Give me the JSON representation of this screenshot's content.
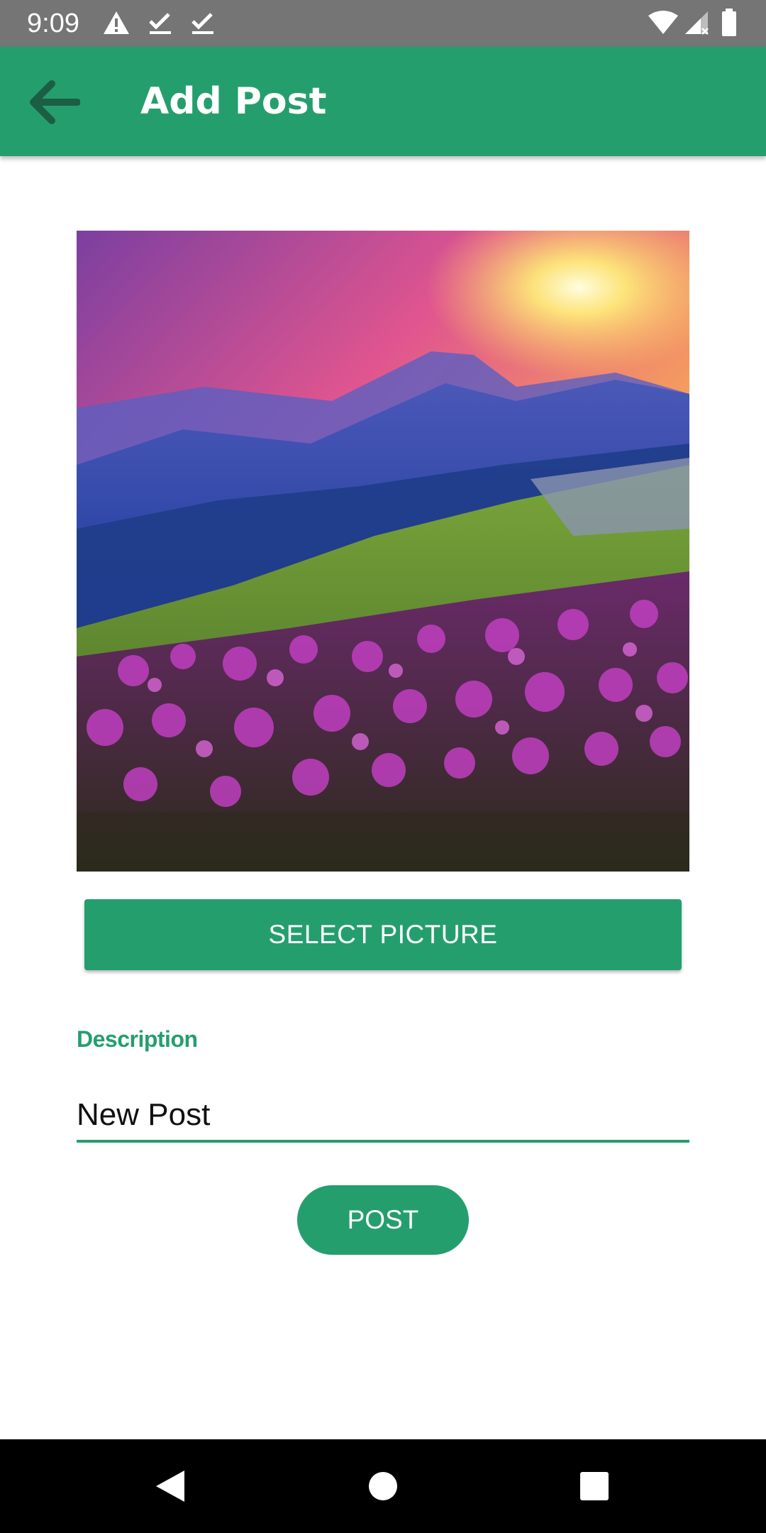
{
  "status_bar": {
    "time": "9:09",
    "left_icons": [
      "warning-icon",
      "check-icon",
      "check-icon"
    ],
    "right_icons": [
      "wifi-icon",
      "signal-icon",
      "battery-icon"
    ]
  },
  "app_bar": {
    "title": "Add Post",
    "back_icon": "arrow-back-icon",
    "color": "#259e6e"
  },
  "preview": {
    "image": "mountain-sunset-flowers-photo"
  },
  "select_button": {
    "label": "SELECT PICTURE"
  },
  "description": {
    "label": "Description",
    "value": "New Post"
  },
  "post_button": {
    "label": "POST"
  },
  "nav_bar": {
    "buttons": [
      "back-triangle-icon",
      "home-circle-icon",
      "recents-square-icon"
    ]
  },
  "colors": {
    "accent": "#259e6e",
    "status_bar": "#757575",
    "nav_bar": "#000000"
  }
}
